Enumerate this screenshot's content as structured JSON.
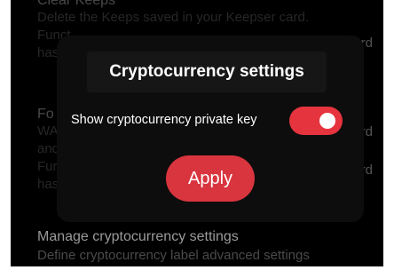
{
  "background": {
    "clear_keeps": {
      "title": "Clear Keeps",
      "desc_1": "Delete the Keeps saved in your Keepser card.",
      "desc_2": "Funct",
      "desc_3": "has"
    },
    "fourth_item": {
      "title": "Fo",
      "desc_1": "WA",
      "desc_2": "and",
      "desc_3": "Fur",
      "desc_4": "has"
    },
    "fragments": {
      "f1": "word",
      "f2": "ard",
      "f3": "rd"
    },
    "manage": {
      "title": "Manage cryptocurrency settings",
      "desc": "Define cryptocurrency label advanced settings"
    }
  },
  "dialog": {
    "title": "Cryptocurrency settings",
    "setting_label": "Show cryptocurrency private key",
    "toggle_on": true,
    "apply_label": "Apply"
  },
  "colors": {
    "accent": "#e6343f",
    "background": "#000000"
  }
}
